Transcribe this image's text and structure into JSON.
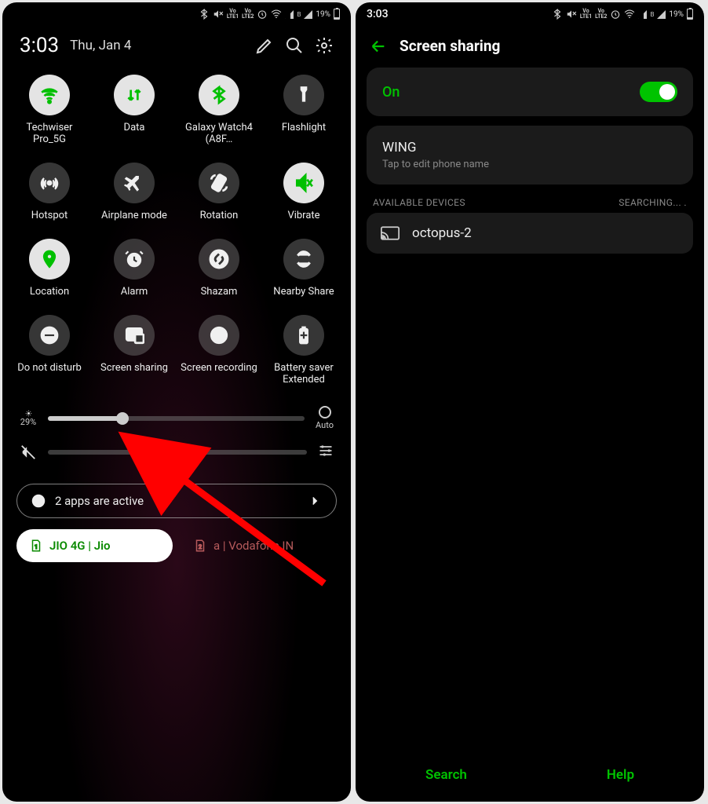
{
  "status": {
    "time": "3:03",
    "battery_pct": "19%"
  },
  "qs": {
    "clock": "3:03",
    "date": "Thu, Jan 4",
    "tiles": [
      {
        "label": "Techwiser Pro_5G",
        "icon": "wifi",
        "on": true
      },
      {
        "label": "Data",
        "icon": "data",
        "on": true
      },
      {
        "label": "Galaxy Watch4 (A8F…",
        "icon": "bluetooth",
        "on": true
      },
      {
        "label": "Flashlight",
        "icon": "flashlight",
        "on": false
      },
      {
        "label": "Hotspot",
        "icon": "hotspot",
        "on": false
      },
      {
        "label": "Airplane mode",
        "icon": "airplane",
        "on": false
      },
      {
        "label": "Rotation",
        "icon": "rotation",
        "on": false
      },
      {
        "label": "Vibrate",
        "icon": "vibrate",
        "on": true
      },
      {
        "label": "Location",
        "icon": "location",
        "on": true
      },
      {
        "label": "Alarm",
        "icon": "alarm",
        "on": false
      },
      {
        "label": "Shazam",
        "icon": "shazam",
        "on": false
      },
      {
        "label": "Nearby Share",
        "icon": "nearby",
        "on": false
      },
      {
        "label": "Do not disturb",
        "icon": "dnd",
        "on": false
      },
      {
        "label": "Screen sharing",
        "icon": "cast",
        "on": false
      },
      {
        "label": "Screen recording",
        "icon": "record",
        "on": false
      },
      {
        "label": "Battery saver Extended",
        "icon": "battery",
        "on": false
      }
    ],
    "brightness_pct": "29%",
    "auto_label": "Auto",
    "brightness_value": 29,
    "apps_active": "2 apps are active",
    "sim1": "JIO 4G | Jio",
    "sim2": "a | Vodafone IN",
    "sim2_badge": "2"
  },
  "ss": {
    "title": "Screen sharing",
    "on_label": "On",
    "wing_title": "WING",
    "wing_sub": "Tap to edit phone name",
    "avail_label": "AVAILABLE DEVICES",
    "searching": "SEARCHING...",
    "device": "octopus-2",
    "search": "Search",
    "help": "Help"
  }
}
